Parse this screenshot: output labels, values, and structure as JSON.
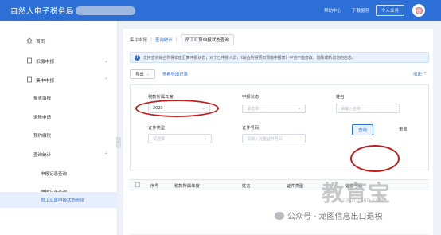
{
  "header": {
    "app_title": "自然人电子税务局",
    "links": [
      "帮助中心",
      "下载服务"
    ],
    "center_button": "个人业务"
  },
  "sidebar": {
    "items": [
      {
        "label": "首页",
        "icon": "home-icon"
      },
      {
        "label": "扣缴申报",
        "icon": "file-icon"
      },
      {
        "label": "集中申报",
        "icon": "file-icon"
      }
    ],
    "sub_items": [
      "报表填报",
      "退税申请",
      "预约缴税",
      "查询统计"
    ],
    "sub_sub_items": [
      "申报记录查询",
      "缴税记录查询",
      "员工汇算申报状态查询"
    ],
    "collapse_glyph": "‹"
  },
  "main": {
    "breadcrumb": [
      "集中申报",
      "查询统计",
      "员工汇算申报状态查询"
    ],
    "notice": "支持查询综合所得年度汇算申报状态，对于已申报人员，《综合所得预扣预缴申报表》中信不能修改、删除或新增信的信息。",
    "export_label": "导出",
    "export_records_label": "查看导出记录",
    "collapse_label": "收起",
    "form": {
      "tax_year": {
        "label": "税款所属年度",
        "value": "2023"
      },
      "declare_status": {
        "label": "申报状态",
        "placeholder": "请选择"
      },
      "name": {
        "label": "姓名",
        "placeholder": "请输入名称"
      },
      "id_type": {
        "label": "证件类型",
        "placeholder": "请选择"
      },
      "id_number": {
        "label": "证件号码",
        "placeholder": "请输入完整证件号码"
      }
    },
    "query_button": "查询",
    "reset_button": "重置",
    "table_headers": [
      "序号",
      "税款所属年度",
      "姓名",
      "证件类型",
      "证件号码"
    ]
  },
  "watermark": {
    "big": "教育宝",
    "url": "JIAOYUBAO.COM",
    "line": "公众号 · 龙图信息出口退税"
  },
  "colors": {
    "primary": "#2c6fd6",
    "annotation": "#c21d1d"
  }
}
